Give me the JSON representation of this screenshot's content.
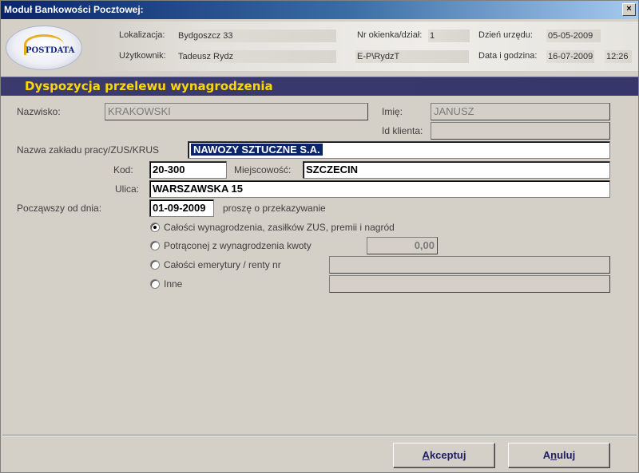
{
  "window": {
    "title": "Moduł Bankowości Pocztowej:",
    "close_symbol": "×"
  },
  "logo": {
    "text": "POSTDATA"
  },
  "header": {
    "location_label": "Lokalizacja:",
    "location_value": "Bydgoszcz 33",
    "window_label": "Nr okienka/dział:",
    "window_value": "1",
    "office_day_label": "Dzień urzędu:",
    "office_day_value": "05-05-2009",
    "user_label": "Użytkownik:",
    "user_value": "Tadeusz Rydz",
    "user_login": "E-P\\RydzT",
    "datetime_label": "Data i godzina:",
    "date_value": "16-07-2009",
    "time_value": "12:26"
  },
  "banner": {
    "title": "Dyspozycja przelewu wynagrodzenia"
  },
  "form": {
    "surname_label": "Nazwisko:",
    "surname_value": "KRAKOWSKI",
    "firstname_label": "Imię:",
    "firstname_value": "JANUSZ",
    "client_id_label": "Id klienta:",
    "client_id_value": "",
    "employer_label": "Nazwa zakładu pracy/ZUS/KRUS",
    "employer_value": "NAWOZY SZTUCZNE S.A.",
    "postcode_label": "Kod:",
    "postcode_value": "20-300",
    "city_label": "Miejscowość:",
    "city_value": "SZCZECIN",
    "street_label": "Ulica:",
    "street_value": "WARSZAWSKA 15",
    "start_date_label": "Począwszy od dnia:",
    "start_date_value": "01-09-2009",
    "request_text": "proszę o przekazywanie",
    "options": [
      {
        "label": "Całości wynagrodzenia, zasiłków ZUS, premii i nagród",
        "checked": true
      },
      {
        "label": "Potrąconej z wynagrodzenia kwoty",
        "checked": false
      },
      {
        "label": "Całości emerytury / renty nr",
        "checked": false
      },
      {
        "label": "Inne",
        "checked": false
      }
    ],
    "deducted_amount": "0,00",
    "pension_number": "",
    "other_value": ""
  },
  "buttons": {
    "accept_mnemonic": "A",
    "accept_rest": "kceptuj",
    "cancel_prefix": "A",
    "cancel_mnemonic": "n",
    "cancel_rest": "uluj"
  }
}
